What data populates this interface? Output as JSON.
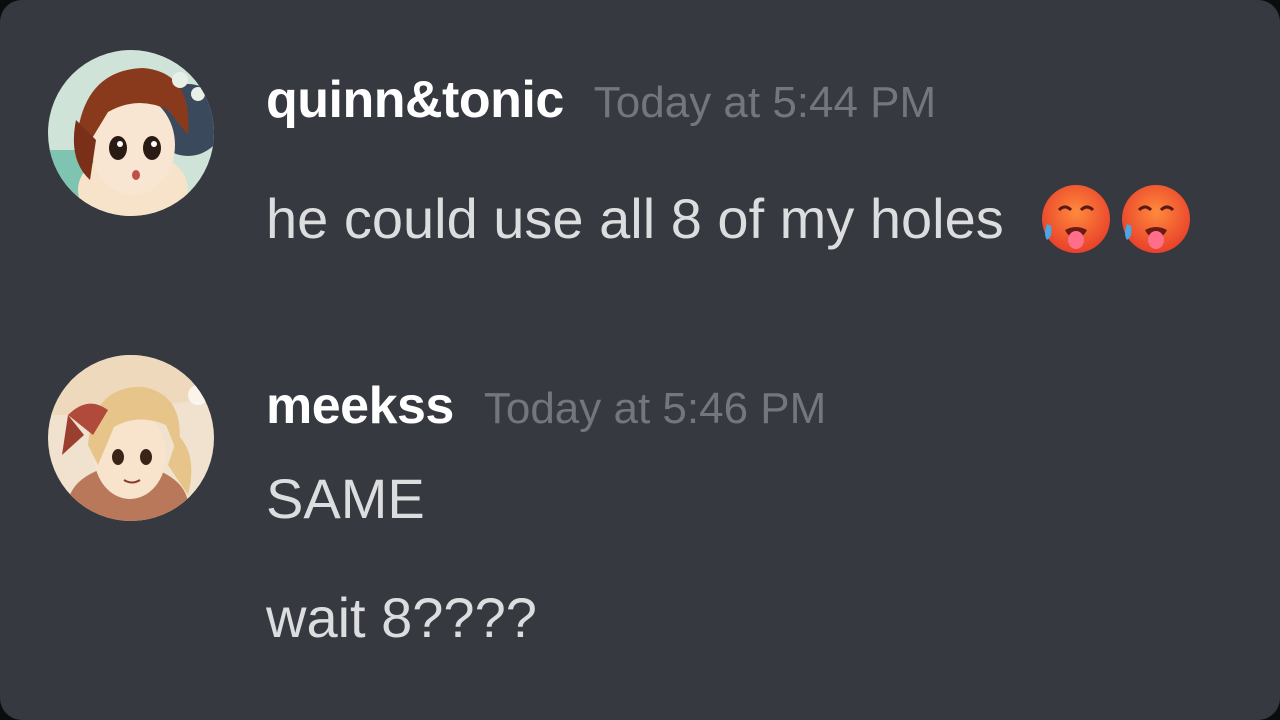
{
  "messages": [
    {
      "username": "quinn&tonic",
      "timestamp": "Today at 5:44 PM",
      "avatar_icon": "anime-avatar-brown-hair",
      "lines": [
        {
          "text": "he could use all 8 of my holes",
          "emojis": [
            "hot-face-emoji",
            "hot-face-emoji"
          ]
        }
      ]
    },
    {
      "username": "meekss",
      "timestamp": "Today at 5:46 PM",
      "avatar_icon": "anime-avatar-blonde-hair",
      "lines": [
        {
          "text": "SAME"
        },
        {
          "text": "wait 8????"
        }
      ]
    }
  ],
  "colors": {
    "background": "#36393f",
    "username": "#ffffff",
    "timestamp": "#72767d",
    "message_text": "#dcddde"
  }
}
